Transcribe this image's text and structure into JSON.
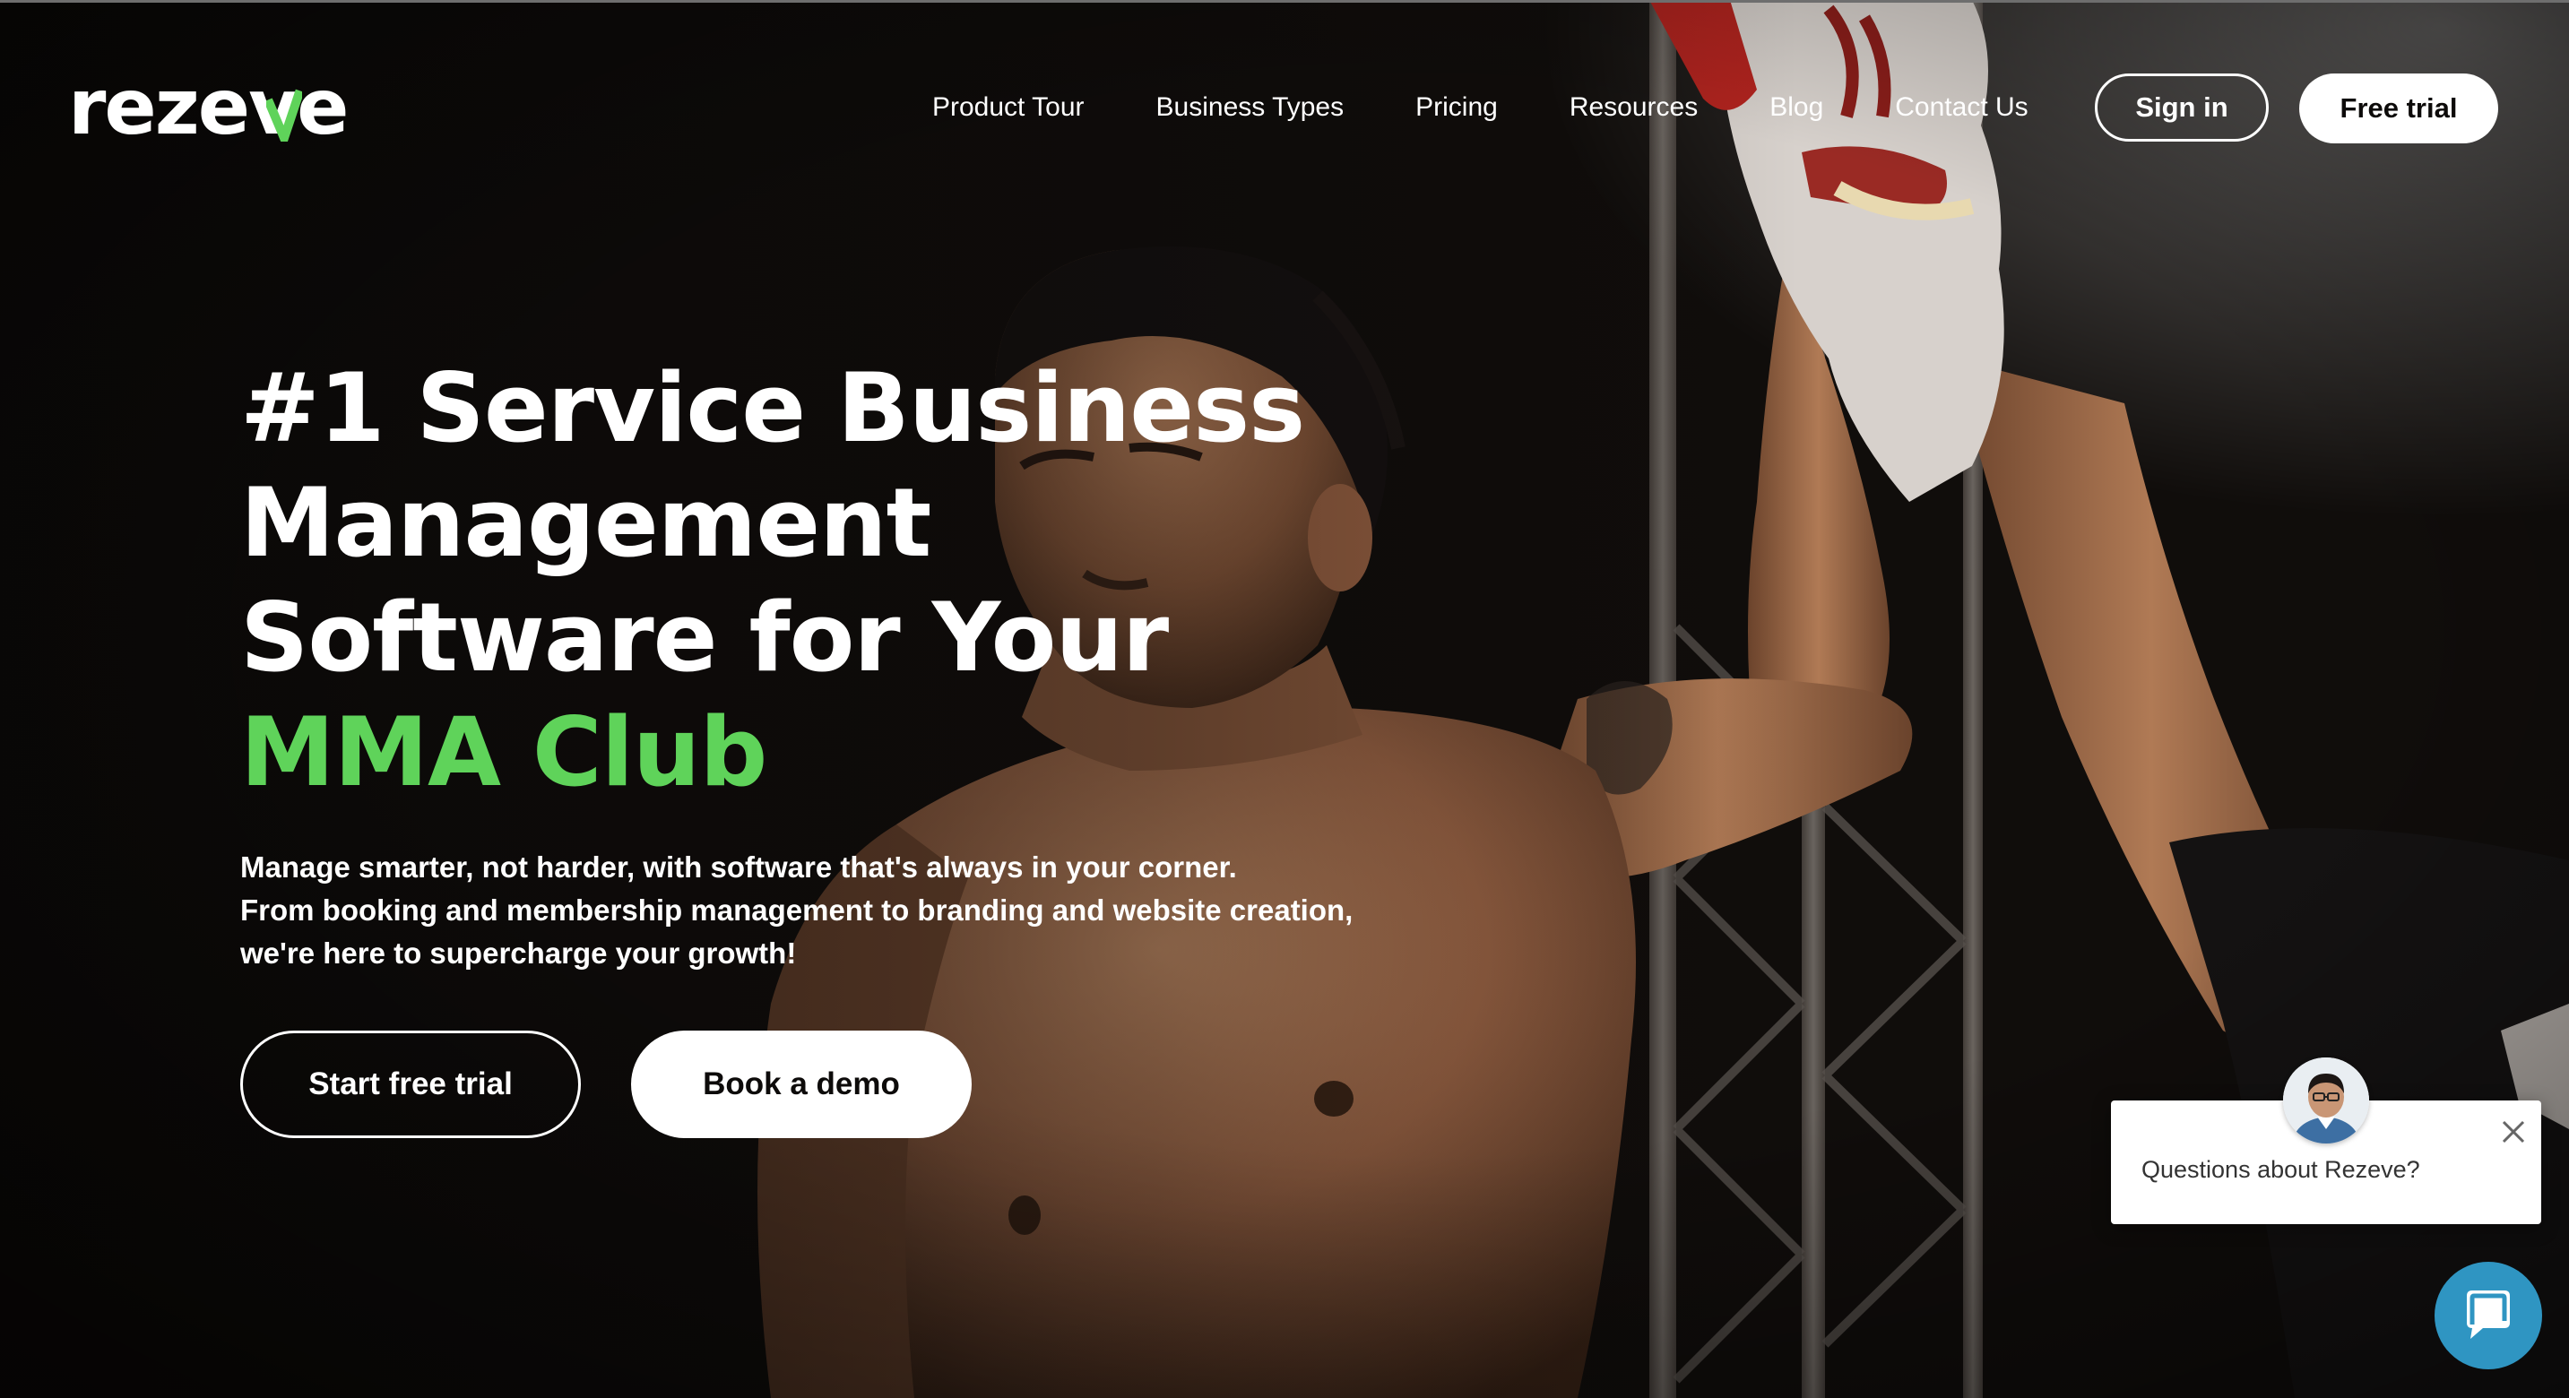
{
  "brand": {
    "logo_text": "rezeve",
    "accent_color": "#5fd35a"
  },
  "nav": {
    "items": [
      {
        "label": "Product Tour"
      },
      {
        "label": "Business Types"
      },
      {
        "label": "Pricing"
      },
      {
        "label": "Resources"
      },
      {
        "label": "Blog"
      },
      {
        "label": "Contact Us"
      }
    ],
    "sign_in": "Sign in",
    "free_trial": "Free trial"
  },
  "hero": {
    "headline_lines": [
      "#1 Service Business",
      "Management",
      "Software for Your"
    ],
    "headline_accent": "MMA Club",
    "subtext_lines": [
      "Manage smarter, not harder, with software that's always in your corner.",
      "From booking and membership management to branding and website creation,",
      "we're here to supercharge your growth!"
    ],
    "cta_primary": "Start free trial",
    "cta_secondary": "Book a demo"
  },
  "chat": {
    "message": "Questions about Rezeve?",
    "launcher_color": "#2f95c2",
    "close_icon": "close-icon",
    "avatar_icon": "agent-avatar"
  }
}
